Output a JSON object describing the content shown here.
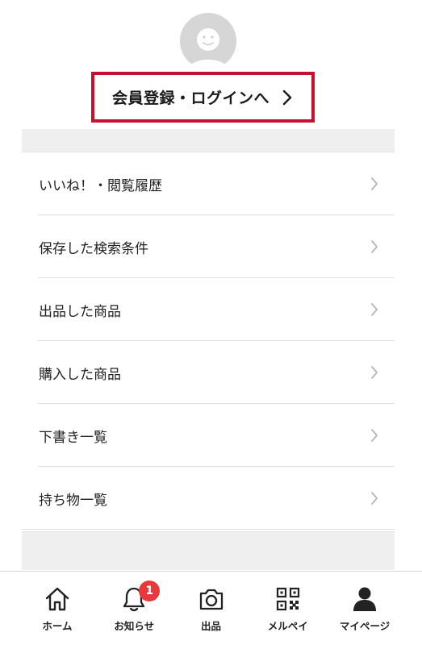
{
  "login": {
    "label": "会員登録・ログインへ"
  },
  "menu": {
    "items": [
      {
        "label": "いいね！・閲覧履歴"
      },
      {
        "label": "保存した検索条件"
      },
      {
        "label": "出品した商品"
      },
      {
        "label": "購入した商品"
      },
      {
        "label": "下書き一覧"
      },
      {
        "label": "持ち物一覧"
      }
    ]
  },
  "tabbar": {
    "items": [
      {
        "label": "ホーム",
        "icon": "home-icon"
      },
      {
        "label": "お知らせ",
        "icon": "bell-icon",
        "badge": "1"
      },
      {
        "label": "出品",
        "icon": "camera-icon"
      },
      {
        "label": "メルペイ",
        "icon": "qr-code-icon"
      },
      {
        "label": "マイページ",
        "icon": "person-icon"
      }
    ]
  },
  "colors": {
    "accent_border": "#c8102e",
    "badge": "#e5393b",
    "band": "#efefef",
    "avatar": "#d6d6d6"
  }
}
